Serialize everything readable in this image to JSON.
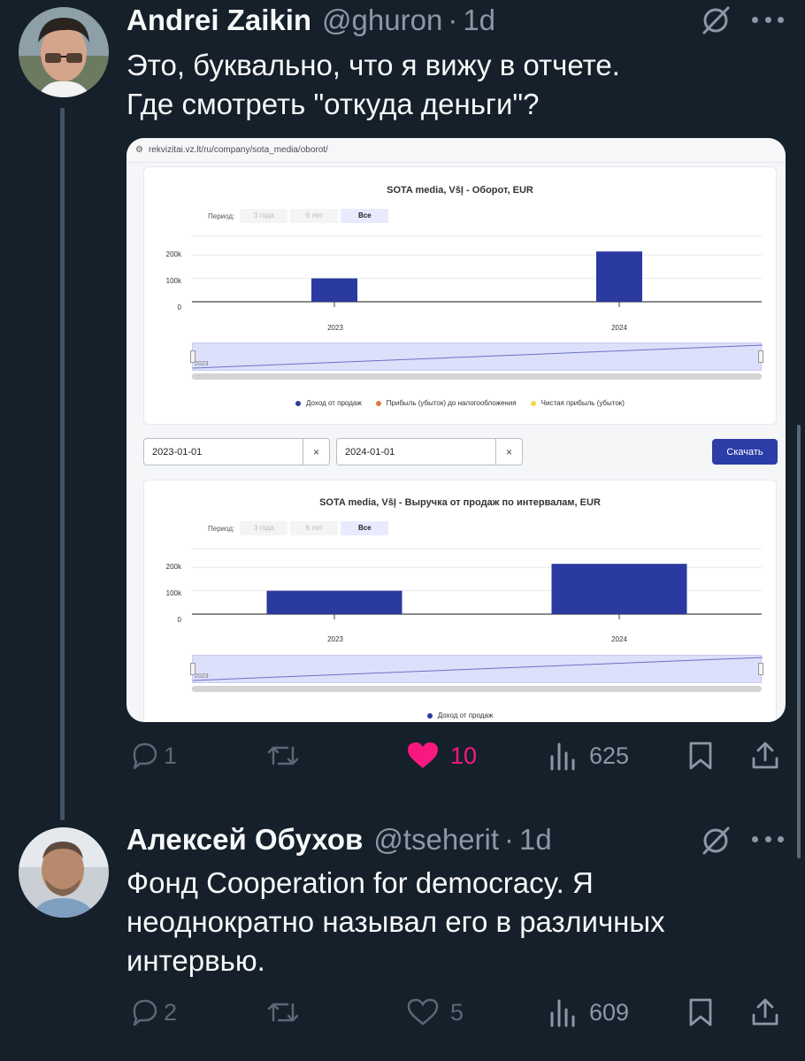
{
  "tweets": [
    {
      "author_name": "Andrei Zaikin",
      "handle": "@ghuron",
      "separator": "·",
      "time": "1d",
      "text_lines": [
        "Это, буквально, что я вижу в отчете.",
        "Где смотреть \"откуда деньги\"?"
      ],
      "stats": {
        "replies": "1",
        "likes": "10",
        "views": "625"
      },
      "liked": true
    },
    {
      "author_name": "Алексей Обухов",
      "handle": "@tseherit",
      "separator": "·",
      "time": "1d",
      "text_lines": [
        "Фонд Cooperation for democracy. Я",
        "неоднократно называл его в различных",
        "интервью."
      ],
      "stats": {
        "replies": "2",
        "likes": "5",
        "views": "609"
      },
      "liked": false
    }
  ],
  "screenshot": {
    "url": "rekvizitai.vz.lt/ru/company/sota_media/oborot/",
    "period_label": "Период:",
    "period_options": [
      "3 года",
      "6 лет",
      "Все"
    ],
    "period_selected": "Все",
    "date_from": "2023-01-01",
    "date_to": "2024-01-01",
    "clear_symbol": "×",
    "download_label": "Скачать",
    "navigator_label": "2023",
    "legend1": [
      {
        "name": "Доход от продаж",
        "color": "#2b3aa0"
      },
      {
        "name": "Прибыль (убыток) до налогообложения",
        "color": "#e07b45"
      },
      {
        "name": "Чистая прибыль (убыток)",
        "color": "#f0d84a"
      }
    ],
    "legend2": [
      {
        "name": "Доход от продаж",
        "color": "#2b3aa0"
      }
    ]
  },
  "chart_data": [
    {
      "type": "bar",
      "title": "SOTA media, VšĮ - Оборот, EUR",
      "categories": [
        "2023",
        "2024"
      ],
      "yticks": [
        "200k",
        "100k",
        "0"
      ],
      "ylim": [
        0,
        280000
      ],
      "series": [
        {
          "name": "Доход от продаж",
          "values": [
            100000,
            215000
          ]
        },
        {
          "name": "Прибыль (убыток) до налогообложения",
          "values": []
        },
        {
          "name": "Чистая прибыль (убыток)",
          "values": []
        }
      ],
      "bar_color": "#2b3aa0",
      "grid": true,
      "legend": "bottom"
    },
    {
      "type": "bar",
      "title": "SOTA media, VšĮ - Выручка от продаж по интервалам, EUR",
      "categories": [
        "2023",
        "2024"
      ],
      "yticks": [
        "200k",
        "100k",
        "0"
      ],
      "ylim": [
        0,
        280000
      ],
      "series": [
        {
          "name": "Доход от продаж",
          "values": [
            100000,
            215000
          ]
        }
      ],
      "bar_color": "#2b3aa0",
      "grid": true,
      "legend": "bottom"
    }
  ],
  "colors": {
    "background": "#15202b",
    "like": "#f91880",
    "thread_line": "#425364",
    "muted": "#8b98a5"
  }
}
